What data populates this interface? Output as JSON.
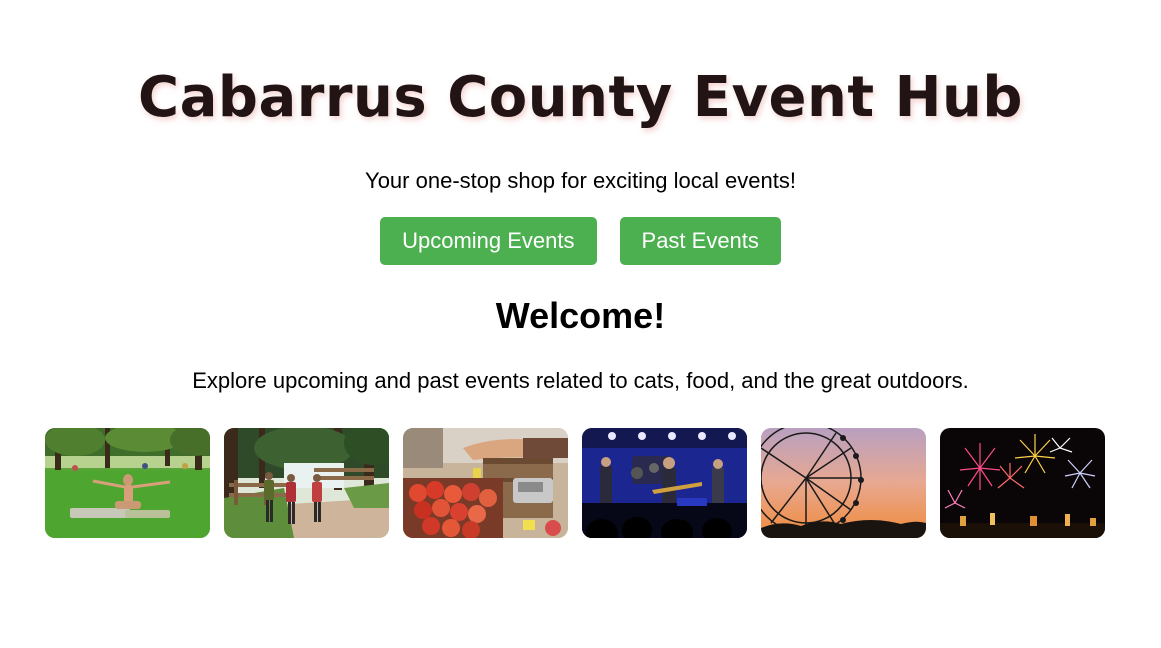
{
  "header": {
    "title": "Cabarrus County Event Hub",
    "tagline": "Your one-stop shop for exciting local events!"
  },
  "nav": {
    "upcoming_label": "Upcoming Events",
    "past_label": "Past Events"
  },
  "main": {
    "welcome_heading": "Welcome!",
    "intro_text": "Explore upcoming and past events related to cats, food, and the great outdoors."
  },
  "gallery": [
    {
      "name": "yoga-in-park-photo"
    },
    {
      "name": "hiking-trail-photo"
    },
    {
      "name": "farmers-market-photo"
    },
    {
      "name": "live-concert-photo"
    },
    {
      "name": "ferris-wheel-sunset-photo"
    },
    {
      "name": "fireworks-photo"
    }
  ],
  "colors": {
    "button_bg": "#4caf50",
    "button_text": "#ffffff",
    "title_text": "#221414"
  }
}
